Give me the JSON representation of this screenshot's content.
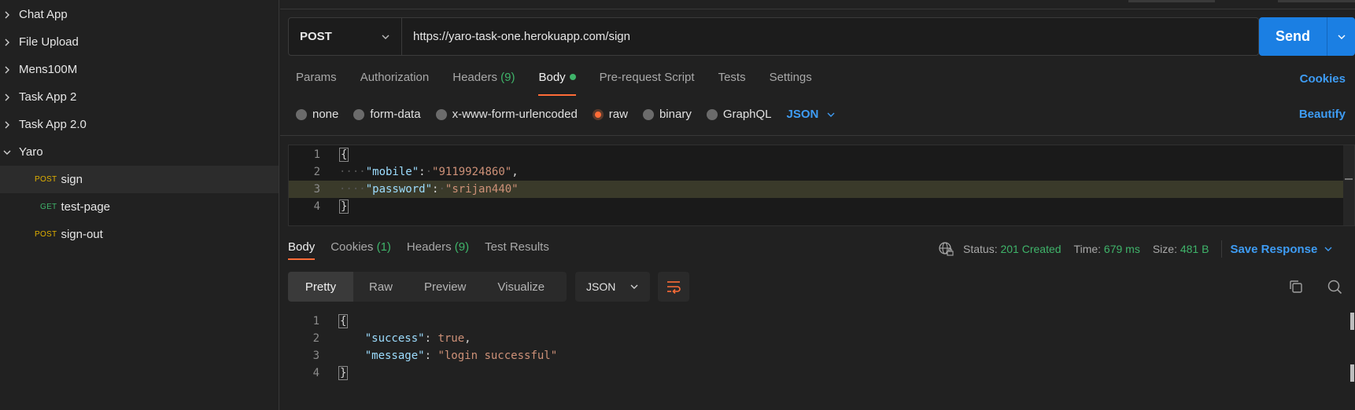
{
  "sidebar": {
    "items": [
      {
        "label": "Chat App",
        "expanded": false
      },
      {
        "label": "File Upload",
        "expanded": false
      },
      {
        "label": "Mens100M",
        "expanded": false
      },
      {
        "label": "Task App 2",
        "expanded": false
      },
      {
        "label": "Task App 2.0",
        "expanded": false
      },
      {
        "label": "Yaro",
        "expanded": true
      }
    ],
    "children": [
      {
        "method": "POST",
        "label": "sign",
        "selected": true
      },
      {
        "method": "GET",
        "label": "test-page",
        "selected": false
      },
      {
        "method": "POST",
        "label": "sign-out",
        "selected": false
      }
    ]
  },
  "request": {
    "method": "POST",
    "url": "https://yaro-task-one.herokuapp.com/sign",
    "send_label": "Send",
    "tabs": {
      "params": "Params",
      "authorization": "Authorization",
      "headers": "Headers",
      "headers_count": "(9)",
      "body": "Body",
      "prerequest": "Pre-request Script",
      "tests": "Tests",
      "settings": "Settings"
    },
    "cookies_link": "Cookies",
    "body_options": {
      "none": "none",
      "form_data": "form-data",
      "urlencoded": "x-www-form-urlencoded",
      "raw": "raw",
      "binary": "binary",
      "graphql": "GraphQL",
      "format": "JSON"
    },
    "beautify_link": "Beautify",
    "body_lines": {
      "n1": "1",
      "n2": "2",
      "n3": "3",
      "n4": "4",
      "open": "{",
      "key1": "\"mobile\"",
      "val1": "\"9119924860\"",
      "key2": "\"password\"",
      "val2": "\"srijan440\"",
      "close": "}"
    }
  },
  "response": {
    "tabs": {
      "body": "Body",
      "cookies": "Cookies",
      "cookies_count": "(1)",
      "headers": "Headers",
      "headers_count": "(9)",
      "test_results": "Test Results"
    },
    "status_label": "Status:",
    "status_value": "201 Created",
    "time_label": "Time:",
    "time_value": "679 ms",
    "size_label": "Size:",
    "size_value": "481 B",
    "save_label": "Save Response",
    "views": {
      "pretty": "Pretty",
      "raw": "Raw",
      "preview": "Preview",
      "visualize": "Visualize"
    },
    "format": "JSON",
    "body_lines": {
      "n1": "1",
      "n2": "2",
      "n3": "3",
      "n4": "4",
      "open": "{",
      "key1": "\"success\"",
      "val1": "true",
      "key2": "\"message\"",
      "val2": "\"login successful\"",
      "close": "}"
    }
  },
  "colors": {
    "accent": "#ff6c37",
    "send": "#1b7fe3",
    "link": "#3e9cf4",
    "success": "#3fb46a",
    "post": "#e0b000"
  }
}
